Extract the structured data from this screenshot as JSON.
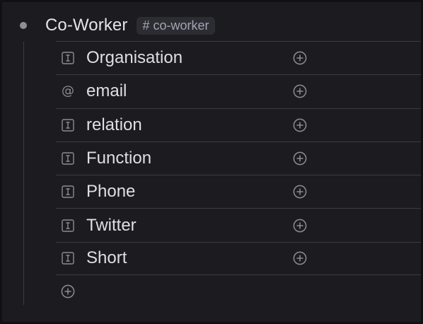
{
  "node": {
    "title": "Co-Worker",
    "tag": "# co-worker"
  },
  "fields": [
    {
      "icon": "text-field-icon",
      "label": "Organisation"
    },
    {
      "icon": "at-sign-icon",
      "label": "email"
    },
    {
      "icon": "text-field-icon",
      "label": "relation"
    },
    {
      "icon": "text-field-icon",
      "label": "Function"
    },
    {
      "icon": "text-field-icon",
      "label": "Phone"
    },
    {
      "icon": "text-field-icon",
      "label": "Twitter"
    },
    {
      "icon": "text-field-icon",
      "label": "Short"
    }
  ],
  "icons": {
    "at_glyph": "@"
  },
  "colors": {
    "background": "#1c1c20",
    "text": "#dedee4",
    "muted": "#8b8b96",
    "tag_bg": "#2c2c33",
    "divider": "#3b3b42"
  }
}
